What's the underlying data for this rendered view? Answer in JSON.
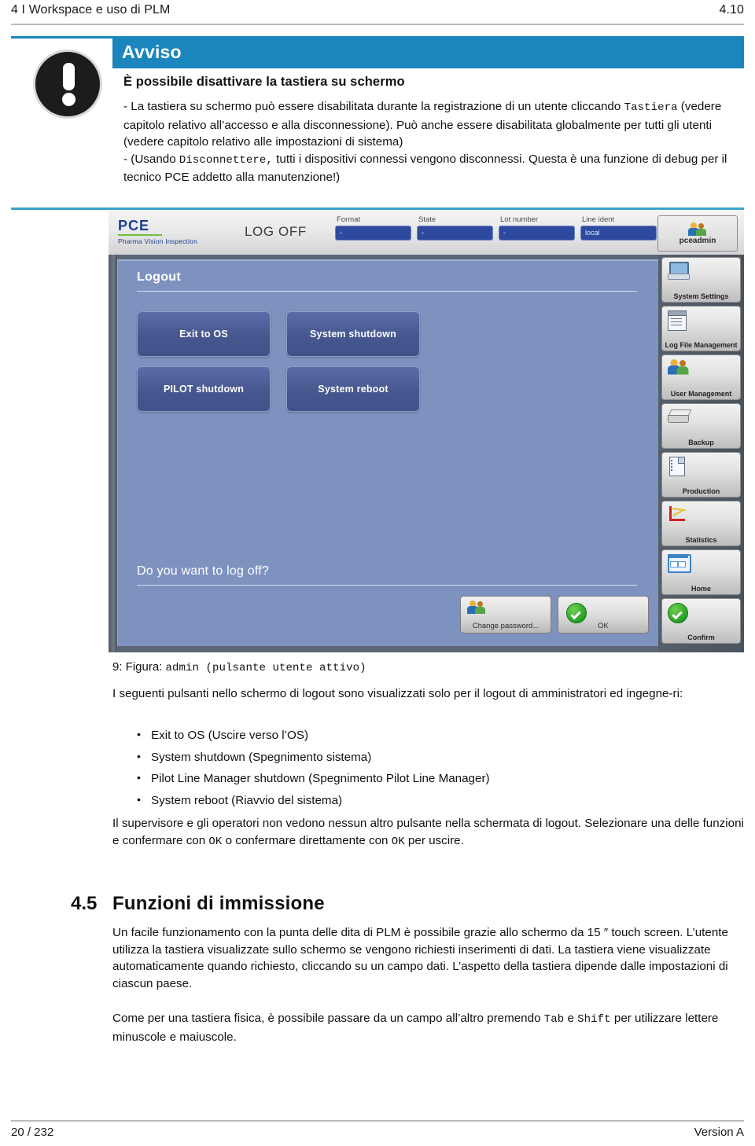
{
  "header": {
    "left": "4 I Workspace e uso di PLM",
    "right": "4.10"
  },
  "notice": {
    "banner_label": "Avviso",
    "icon": "exclamation-icon",
    "title": "È possibile disattivare la tastiera su schermo",
    "para1_a": "- La tastiera su schermo può essere disabilitata durante la registrazione di un utente cliccando ",
    "para1_code": "Tastiera",
    "para1_b": " (vedere capitolo relativo all’accesso e alla disconnessione). Può anche essere disabilitata globalmente per tutti gli utenti (vedere capitolo relativo alle impostazioni di sistema)",
    "para2_a": "- (Usando ",
    "para2_code": "Disconnettere,",
    "para2_b": " tutti i dispositivi connessi vengono disconnessi. Questa è una funzione di debug per il tecnico PCE addetto alla manutenzione!)"
  },
  "screenshot": {
    "logo_main": "PCE",
    "logo_sub": "Pharma Vision Inspection",
    "mode_label": "LOG OFF",
    "fields": [
      {
        "label": "Format",
        "value": "-"
      },
      {
        "label": "State",
        "value": "-"
      },
      {
        "label": "Lot number",
        "value": "-"
      },
      {
        "label": "Line ident",
        "value": "local"
      }
    ],
    "user_button": {
      "label": "pceadmin",
      "icon": "users-icon"
    },
    "panel": {
      "title": "Logout",
      "buttons": [
        "Exit to OS",
        "System shutdown",
        "PILOT shutdown",
        "System reboot"
      ],
      "question": "Do you want to log off?",
      "actions": [
        {
          "label": "Change password...",
          "icon": "users-icon"
        },
        {
          "label": "OK",
          "icon": "check-circle-icon"
        }
      ]
    },
    "rail": [
      {
        "label": "System Settings",
        "icon": "monitor-icon"
      },
      {
        "label": "Log File Management",
        "icon": "notebook-icon"
      },
      {
        "label": "User Management",
        "icon": "users-icon"
      },
      {
        "label": "Backup",
        "icon": "disk-icon"
      },
      {
        "label": "Production",
        "icon": "document-icon"
      },
      {
        "label": "Statistics",
        "icon": "chart-icon"
      },
      {
        "label": "Home",
        "icon": "window-icon"
      },
      {
        "label": "Confirm",
        "icon": "check-circle-icon"
      }
    ]
  },
  "figure": {
    "caption_prefix": "9: Figura: ",
    "caption_code": "admin (pulsante utente attivo)"
  },
  "content": {
    "intro": "I seguenti pulsanti nello schermo di logout sono visualizzati solo per il logout di amministratori ed ingegne-ri:",
    "bullets": [
      "Exit to OS (Uscire verso l’OS)",
      "System shutdown (Spegnimento sistema)",
      "Pilot Line Manager shutdown (Spegnimento Pilot Line Manager)",
      "System reboot (Riavvio del sistema)"
    ],
    "outro_a": "Il supervisore e gli operatori non vedono nessun altro pulsante nella schermata di logout. Selezionare una delle funzioni e confermare con ",
    "outro_code1": "OK",
    "outro_b": " o confermare direttamente con ",
    "outro_code2": "OK",
    "outro_c": " per uscire."
  },
  "section": {
    "number": "4.5",
    "title": "Funzioni di immissione",
    "para1": "Un facile funzionamento con la punta delle dita di PLM è possibile grazie allo schermo da 15 ″ touch screen. L’utente utilizza la tastiera visualizzate sullo schermo se vengono richiesti inserimenti di dati. La tastiera viene visualizzate automaticamente quando richiesto, cliccando su un campo dati. L’aspetto della tastiera dipende dalle impostazioni di ciascun paese.",
    "para2_a": "Come per una tastiera fisica, è possibile passare da un campo all’altro premendo ",
    "para2_code1": "Tab",
    "para2_b": " e ",
    "para2_code2": "Shift",
    "para2_c": " per utilizzare lettere minuscole e maiuscole."
  },
  "footer": {
    "left": "20 / 232",
    "right": "Version A"
  },
  "colors": {
    "accent_blue": "#1b86bd",
    "rule_blue": "#3aa3c9",
    "panel_blue": "#7e92c0",
    "field_blue": "#2e4a9e",
    "logo_blue": "#1b3f8f",
    "logo_green": "#6fbf3a"
  }
}
